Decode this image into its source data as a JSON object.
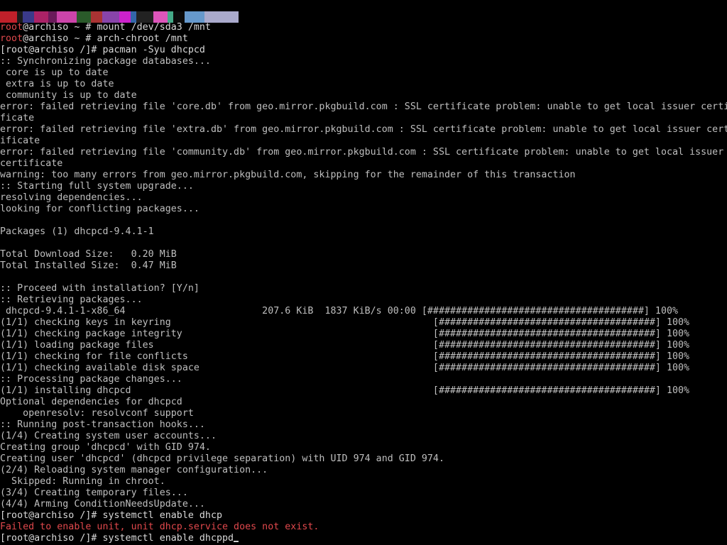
{
  "colors": {
    "background": "#000000",
    "text": "#bfbfbf",
    "root_user": "#e0484c",
    "error_text": "#e0484c",
    "glitch": [
      "#c0202a",
      "#1a1a1a",
      "#3a3a8a",
      "#aa2266",
      "#6a1a5a",
      "#cc44aa",
      "#2a5a2a",
      "#aa3333",
      "#8844aa",
      "#cc22cc",
      "#3366aa",
      "#222222",
      "#dd55bb",
      "#44aa88",
      "#0a0a0a",
      "#6699cc",
      "#aaaacc"
    ]
  },
  "terminal": {
    "cursor_visible": true,
    "lines": [
      [
        {
          "t": "root",
          "c": "red"
        },
        {
          "t": "@archiso ~ # mount /dev/sda3 /mnt",
          "c": "white"
        }
      ],
      [
        {
          "t": "root",
          "c": "red"
        },
        {
          "t": "@archiso ~ # arch-chroot /mnt",
          "c": "white"
        }
      ],
      [
        {
          "t": "[root@archiso /]# pacman -Syu dhcpcd",
          "c": "white"
        }
      ],
      [
        {
          "t": ":: Synchronizing package databases...",
          "c": "gray"
        }
      ],
      [
        {
          "t": " core is up to date",
          "c": "gray"
        }
      ],
      [
        {
          "t": " extra is up to date",
          "c": "gray"
        }
      ],
      [
        {
          "t": " community is up to date",
          "c": "gray"
        }
      ],
      [
        {
          "t": "error: failed retrieving file 'core.db' from geo.mirror.pkgbuild.com : SSL certificate problem: unable to get local issuer certi",
          "c": "gray"
        }
      ],
      [
        {
          "t": "ficate",
          "c": "gray"
        }
      ],
      [
        {
          "t": "error: failed retrieving file 'extra.db' from geo.mirror.pkgbuild.com : SSL certificate problem: unable to get local issuer cert",
          "c": "gray"
        }
      ],
      [
        {
          "t": "ificate",
          "c": "gray"
        }
      ],
      [
        {
          "t": "error: failed retrieving file 'community.db' from geo.mirror.pkgbuild.com : SSL certificate problem: unable to get local issuer",
          "c": "gray"
        }
      ],
      [
        {
          "t": "certificate",
          "c": "gray"
        }
      ],
      [
        {
          "t": "warning: too many errors from geo.mirror.pkgbuild.com, skipping for the remainder of this transaction",
          "c": "gray"
        }
      ],
      [
        {
          "t": ":: Starting full system upgrade...",
          "c": "gray"
        }
      ],
      [
        {
          "t": "resolving dependencies...",
          "c": "gray"
        }
      ],
      [
        {
          "t": "looking for conflicting packages...",
          "c": "gray"
        }
      ],
      [
        {
          "t": "",
          "c": "gray"
        }
      ],
      [
        {
          "t": "Packages (1) dhcpcd-9.4.1-1",
          "c": "gray"
        }
      ],
      [
        {
          "t": "",
          "c": "gray"
        }
      ],
      [
        {
          "t": "Total Download Size:   0.20 MiB",
          "c": "gray"
        }
      ],
      [
        {
          "t": "Total Installed Size:  0.47 MiB",
          "c": "gray"
        }
      ],
      [
        {
          "t": "",
          "c": "gray"
        }
      ],
      [
        {
          "t": ":: Proceed with installation? [Y/n]",
          "c": "gray"
        }
      ],
      [
        {
          "t": ":: Retrieving packages...",
          "c": "gray"
        }
      ],
      [
        {
          "t": " dhcpcd-9.4.1-1-x86_64                        207.6 KiB  1837 KiB/s 00:00 [######################################] 100%",
          "c": "gray"
        }
      ],
      [
        {
          "t": "(1/1) checking keys in keyring                                              [######################################] 100%",
          "c": "gray"
        }
      ],
      [
        {
          "t": "(1/1) checking package integrity                                            [######################################] 100%",
          "c": "gray"
        }
      ],
      [
        {
          "t": "(1/1) loading package files                                                 [######################################] 100%",
          "c": "gray"
        }
      ],
      [
        {
          "t": "(1/1) checking for file conflicts                                           [######################################] 100%",
          "c": "gray"
        }
      ],
      [
        {
          "t": "(1/1) checking available disk space                                         [######################################] 100%",
          "c": "gray"
        }
      ],
      [
        {
          "t": ":: Processing package changes...",
          "c": "gray"
        }
      ],
      [
        {
          "t": "(1/1) installing dhcpcd                                                     [######################################] 100%",
          "c": "gray"
        }
      ],
      [
        {
          "t": "Optional dependencies for dhcpcd",
          "c": "gray"
        }
      ],
      [
        {
          "t": "    openresolv: resolvconf support",
          "c": "gray"
        }
      ],
      [
        {
          "t": ":: Running post-transaction hooks...",
          "c": "gray"
        }
      ],
      [
        {
          "t": "(1/4) Creating system user accounts...",
          "c": "gray"
        }
      ],
      [
        {
          "t": "Creating group 'dhcpcd' with GID 974.",
          "c": "gray"
        }
      ],
      [
        {
          "t": "Creating user 'dhcpcd' (dhcpcd privilege separation) with UID 974 and GID 974.",
          "c": "gray"
        }
      ],
      [
        {
          "t": "(2/4) Reloading system manager configuration...",
          "c": "gray"
        }
      ],
      [
        {
          "t": "  Skipped: Running in chroot.",
          "c": "gray"
        }
      ],
      [
        {
          "t": "(3/4) Creating temporary files...",
          "c": "gray"
        }
      ],
      [
        {
          "t": "(4/4) Arming ConditionNeedsUpdate...",
          "c": "gray"
        }
      ],
      [
        {
          "t": "[root@archiso /]# systemctl enable dhcp",
          "c": "white"
        }
      ],
      [
        {
          "t": "Failed to enable unit, unit dhcp.service does not exist.",
          "c": "red"
        }
      ],
      [
        {
          "t": "[root@archiso /]# systemctl enable dhcppd",
          "c": "white"
        }
      ]
    ]
  }
}
